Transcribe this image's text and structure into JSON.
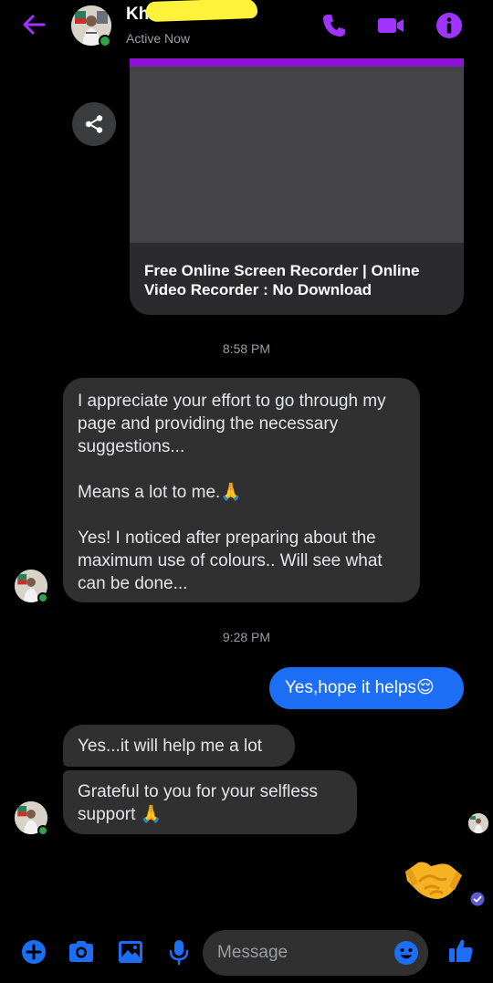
{
  "header": {
    "contact_name": "Kh",
    "status": "Active Now"
  },
  "link_preview": {
    "title": "Free Online Screen Recorder | Online Video Recorder : No Download"
  },
  "timestamps": [
    "8:58 PM",
    "9:28 PM"
  ],
  "messages": {
    "received_1": {
      "line1": "I appreciate your effort to go through my page and providing the necessary suggestions...",
      "line2": "Means a lot to me.🙏",
      "line3": "Yes! I noticed after preparing about the maximum use of colours.. Will see what can be done..."
    },
    "sent_1": "Yes,hope it helps😌",
    "received_2": "Yes...it will help me a lot",
    "received_3": "Grateful to you for your selfless support 🙏",
    "sent_2": "🤝"
  },
  "composer": {
    "placeholder": "Message"
  },
  "colors": {
    "accent": "#a033ff",
    "sent_bubble": "#1c6ef5",
    "received_bubble": "#303030",
    "background": "#000000",
    "online": "#31a24c"
  }
}
